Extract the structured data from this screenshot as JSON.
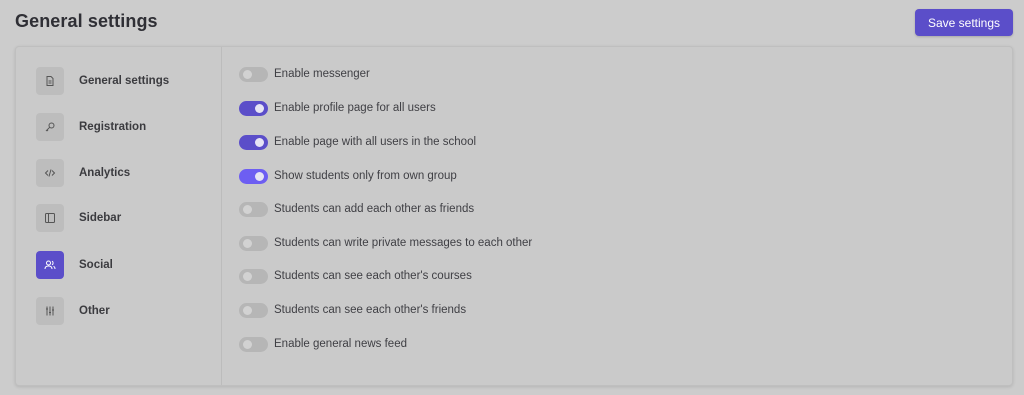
{
  "header": {
    "title": "General settings",
    "save_label": "Save settings",
    "accent_color": "#5b4ec9"
  },
  "sidebar": {
    "items": [
      {
        "label": "General settings",
        "icon": "document-icon",
        "active": false
      },
      {
        "label": "Registration",
        "icon": "key-icon",
        "active": false
      },
      {
        "label": "Analytics",
        "icon": "code-icon",
        "active": false
      },
      {
        "label": "Sidebar",
        "icon": "sidebar-layout-icon",
        "active": false
      },
      {
        "label": "Social",
        "icon": "users-icon",
        "active": true
      },
      {
        "label": "Other",
        "icon": "sliders-icon",
        "active": false
      }
    ]
  },
  "settings": [
    {
      "label": "Enable messenger",
      "enabled": false
    },
    {
      "label": "Enable profile page for all users",
      "enabled": true
    },
    {
      "label": "Enable page with all users in the school",
      "enabled": true
    },
    {
      "label": "Show students only from own group",
      "enabled": true,
      "highlighted": true
    },
    {
      "label": "Students can add each other as friends",
      "enabled": false
    },
    {
      "label": "Students can write private messages to each other",
      "enabled": false
    },
    {
      "label": "Students can see each other's courses",
      "enabled": false
    },
    {
      "label": "Students can see each other's friends",
      "enabled": false
    },
    {
      "label": "Enable general news feed",
      "enabled": false
    }
  ],
  "highlight_color": "#d8472b"
}
